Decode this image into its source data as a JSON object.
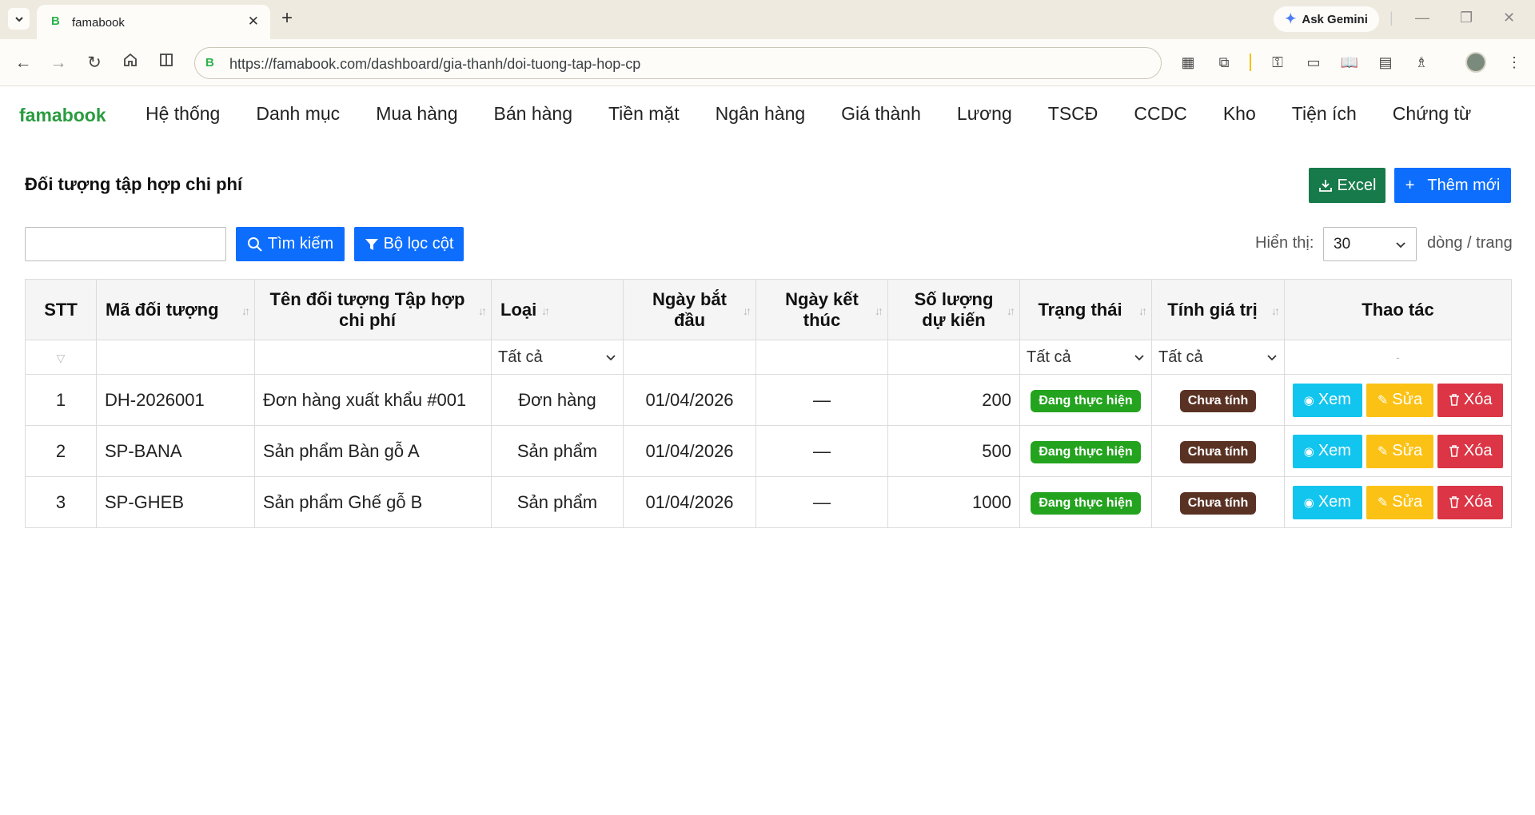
{
  "browser": {
    "tab_title": "famabook",
    "tab_favicon": "B",
    "ask_gemini": "Ask Gemini",
    "url": "https://famabook.com/dashboard/gia-thanh/doi-tuong-tap-hop-cp"
  },
  "nav": {
    "brand": "famabook",
    "items": [
      "Hệ thống",
      "Danh mục",
      "Mua hàng",
      "Bán hàng",
      "Tiền mặt",
      "Ngân hàng",
      "Giá thành",
      "Lương",
      "TSCĐ",
      "CCDC",
      "Kho",
      "Tiện ích",
      "Chứng từ"
    ]
  },
  "page": {
    "title": "Đối tượng tập hợp chi phí",
    "excel_label": "Excel",
    "add_label": "Thêm mới",
    "search_value": "",
    "search_button": "Tìm kiếm",
    "filter_button": "Bộ lọc cột",
    "show_label": "Hiển thị:",
    "page_size": "30",
    "per_page_label": "dòng / trang"
  },
  "table": {
    "headers": {
      "stt": "STT",
      "code": "Mã đối tượng",
      "name": "Tên đối tượng Tập hợp chi phí",
      "type": "Loại",
      "start": "Ngày bắt đầu",
      "end": "Ngày kết thúc",
      "qty": "Số lượng dự kiến",
      "status": "Trạng thái",
      "calc": "Tính giá trị",
      "actions": "Thao tác"
    },
    "filters": {
      "type": "Tất cả",
      "status": "Tất cả",
      "calc": "Tất cả",
      "actions": "-"
    },
    "rows": [
      {
        "stt": "1",
        "code": "DH-2026001",
        "name": "Đơn hàng xuất khẩu #001",
        "type": "Đơn hàng",
        "start": "01/04/2026",
        "end": "—",
        "qty": "200",
        "status": "Đang thực hiện",
        "calc": "Chưa tính"
      },
      {
        "stt": "2",
        "code": "SP-BANA",
        "name": "Sản phẩm Bàn gỗ A",
        "type": "Sản phẩm",
        "start": "01/04/2026",
        "end": "—",
        "qty": "500",
        "status": "Đang thực hiện",
        "calc": "Chưa tính"
      },
      {
        "stt": "3",
        "code": "SP-GHEB",
        "name": "Sản phẩm Ghế gỗ B",
        "type": "Sản phẩm",
        "start": "01/04/2026",
        "end": "—",
        "qty": "1000",
        "status": "Đang thực hiện",
        "calc": "Chưa tính"
      }
    ],
    "action_labels": {
      "view": "Xem",
      "edit": "Sửa",
      "delete": "Xóa"
    }
  },
  "colors": {
    "brand": "#2a9c3f",
    "primary": "#0d6efd",
    "excel": "#177a4a",
    "status_badge": "#24a31f",
    "calc_badge": "#5a3224",
    "view": "#11c5ee",
    "edit": "#fbc215",
    "delete": "#dc3545"
  }
}
